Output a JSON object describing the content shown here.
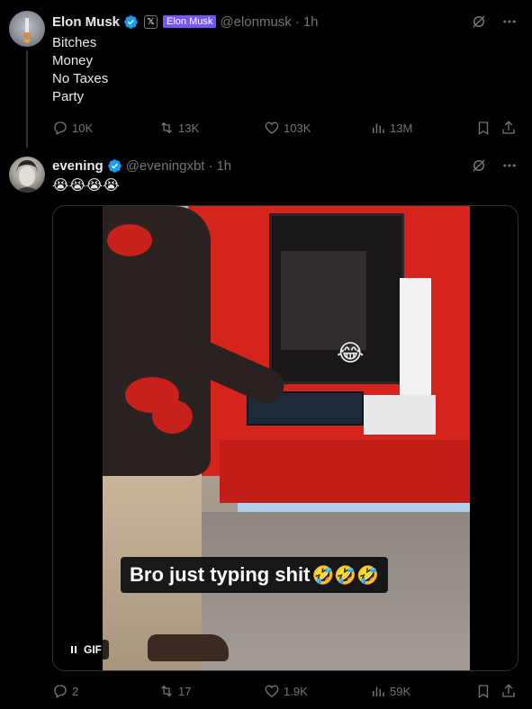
{
  "tweets": [
    {
      "author_name": "Elon Musk",
      "x_badge": "𝕏",
      "affiliation_label": "Elon Musk",
      "handle": "@elonmusk",
      "time": "1h",
      "lines": [
        "Bitches",
        "Money",
        "No Taxes",
        "Party"
      ],
      "stats": {
        "replies": "10K",
        "reposts": "13K",
        "likes": "103K",
        "views": "13M"
      }
    },
    {
      "author_name": "evening",
      "handle": "@eveningxbt",
      "time": "1h",
      "emoji_text": "😭😭😭😭",
      "media": {
        "type": "GIF",
        "badge_label": "GIF",
        "caption_text": "Bro just typing shit",
        "caption_emojis": "🤣🤣🤣"
      },
      "stats": {
        "replies": "2",
        "reposts": "17",
        "likes": "1.9K",
        "views": "59K"
      }
    }
  ],
  "colors": {
    "background": "#000000",
    "text_primary": "#e7e9ea",
    "text_secondary": "#71767b",
    "verified_blue": "#1d9bf0",
    "affiliation_purple": "#7856ff",
    "border": "#2f3336"
  },
  "icons": [
    "verified-icon",
    "grok-icon",
    "more-icon",
    "reply-icon",
    "repost-icon",
    "like-icon",
    "views-icon",
    "bookmark-icon",
    "share-icon",
    "pause-icon"
  ]
}
